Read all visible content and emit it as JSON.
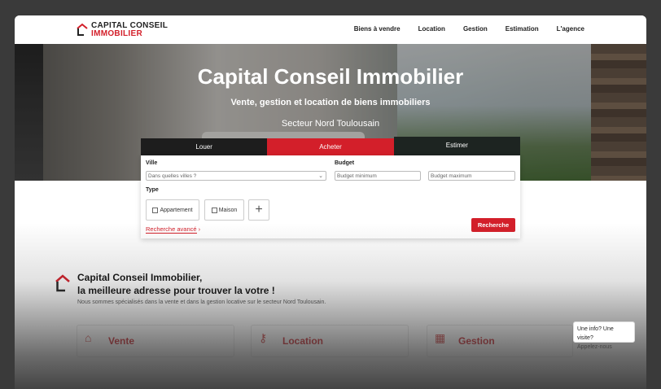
{
  "header": {
    "logo_line1": "CAPITAL CONSEIL",
    "logo_line2": "IMMOBILIER",
    "nav": [
      "Biens à vendre",
      "Location",
      "Gestion",
      "Estimation",
      "L'agence"
    ]
  },
  "hero": {
    "title": "Capital Conseil Immobilier",
    "subtitle": "Vente, gestion et location de biens immobiliers",
    "area": "Secteur Nord Toulousain"
  },
  "search": {
    "tabs": [
      "Louer",
      "Acheter",
      "Estimer"
    ],
    "active_tab": "Acheter",
    "ville_label": "Ville",
    "ville_placeholder": "Dans quelles villes ?",
    "budget_label": "Budget",
    "budget_min_placeholder": "Budget minimum",
    "budget_max_placeholder": "Budget maximum",
    "type_label": "Type",
    "type_options": [
      "Appartement",
      "Maison"
    ],
    "advanced_label": "Recherche avancé",
    "submit_label": "Recherche"
  },
  "about": {
    "title_line1": "Capital Conseil Immobilier,",
    "title_line2": "la meilleure adresse pour trouver la votre !",
    "description": "Nous sommes spécialisés dans la vente et dans la gestion locative sur le secteur Nord Toulousain."
  },
  "services": [
    "Vente",
    "Location",
    "Gestion"
  ],
  "chat": {
    "line1": "Une info? Une visite?",
    "line2": "Appelez-nous"
  },
  "colors": {
    "accent": "#d31f2a",
    "dark_tab": "#1d1d1d",
    "outer_frame": "#3a3a3a"
  }
}
